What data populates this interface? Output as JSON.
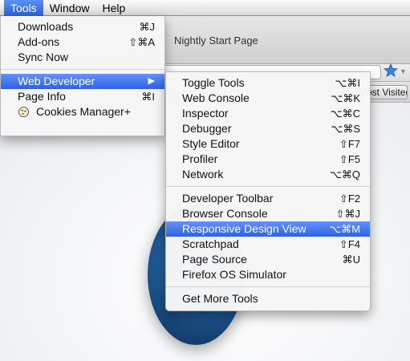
{
  "menubar": {
    "items": [
      {
        "label": "Tools",
        "active": true
      },
      {
        "label": "Window",
        "active": false
      },
      {
        "label": "Help",
        "active": false
      }
    ]
  },
  "background": {
    "tab_title": "Nightly Start Page",
    "most_visited": "Most Visited"
  },
  "tools_menu": {
    "items": [
      {
        "label": "Downloads",
        "shortcut": "⌘J"
      },
      {
        "label": "Add-ons",
        "shortcut": "⇧⌘A"
      },
      {
        "label": "Sync Now",
        "shortcut": ""
      },
      {
        "label": "Web Developer",
        "shortcut": "▶",
        "highlighted": true
      },
      {
        "label": "Page Info",
        "shortcut": "⌘I"
      },
      {
        "label": "Cookies Manager+",
        "shortcut": "",
        "icon": "cookie-icon"
      }
    ]
  },
  "webdev_menu": {
    "group1": [
      {
        "label": "Toggle Tools",
        "shortcut": "⌥⌘I"
      },
      {
        "label": "Web Console",
        "shortcut": "⌥⌘K"
      },
      {
        "label": "Inspector",
        "shortcut": "⌥⌘C"
      },
      {
        "label": "Debugger",
        "shortcut": "⌥⌘S"
      },
      {
        "label": "Style Editor",
        "shortcut": "⇧F7"
      },
      {
        "label": "Profiler",
        "shortcut": "⇧F5"
      },
      {
        "label": "Network",
        "shortcut": "⌥⌘Q"
      }
    ],
    "group2": [
      {
        "label": "Developer Toolbar",
        "shortcut": "⇧F2"
      },
      {
        "label": "Browser Console",
        "shortcut": "⇧⌘J"
      },
      {
        "label": "Responsive Design View",
        "shortcut": "⌥⌘M",
        "highlighted": true
      },
      {
        "label": "Scratchpad",
        "shortcut": "⇧F4"
      },
      {
        "label": "Page Source",
        "shortcut": "⌘U"
      },
      {
        "label": "Firefox OS Simulator",
        "shortcut": ""
      }
    ],
    "group3": [
      {
        "label": "Get More Tools",
        "shortcut": ""
      }
    ]
  },
  "colors": {
    "highlight": "#2c62e5",
    "menu_bg": "#f6f6f6"
  }
}
